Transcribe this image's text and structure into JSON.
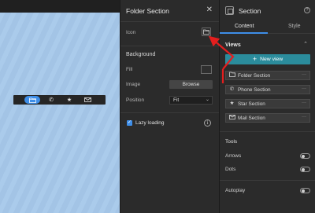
{
  "canvas": {
    "navbar": {
      "items": [
        {
          "name": "folder",
          "active": true
        },
        {
          "name": "phone",
          "active": false
        },
        {
          "name": "star",
          "active": false
        },
        {
          "name": "mail",
          "active": false
        }
      ]
    },
    "background_color": "#a6c8ea",
    "navbar_active_color": "#3e8ee8"
  },
  "settings_panel": {
    "title": "Folder Section",
    "icon_label": "Icon",
    "background_heading": "Background",
    "fill_label": "Fill",
    "image_label": "Image",
    "browse_label": "Browse",
    "position_label": "Position",
    "position_value": "Fit",
    "lazy_loading_label": "Lazy loading",
    "lazy_loading_checked": true
  },
  "section_panel": {
    "title": "Section",
    "tabs": [
      {
        "label": "Content",
        "active": true
      },
      {
        "label": "Style",
        "active": false
      }
    ],
    "views_heading": "Views",
    "new_view_label": "New view",
    "views": [
      {
        "label": "Folder Section",
        "icon": "folder-icon"
      },
      {
        "label": "Phone Section",
        "icon": "phone-icon"
      },
      {
        "label": "Star Section",
        "icon": "star-icon"
      },
      {
        "label": "Mail Section",
        "icon": "mail-icon"
      }
    ],
    "tools_heading": "Tools",
    "arrows_label": "Arrows",
    "arrows_on": false,
    "dots_label": "Dots",
    "dots_on": false,
    "autoplay_label": "Autoplay",
    "autoplay_on": false,
    "accent_color": "#2b8c9c"
  },
  "annotation_color": "#e41e1e"
}
